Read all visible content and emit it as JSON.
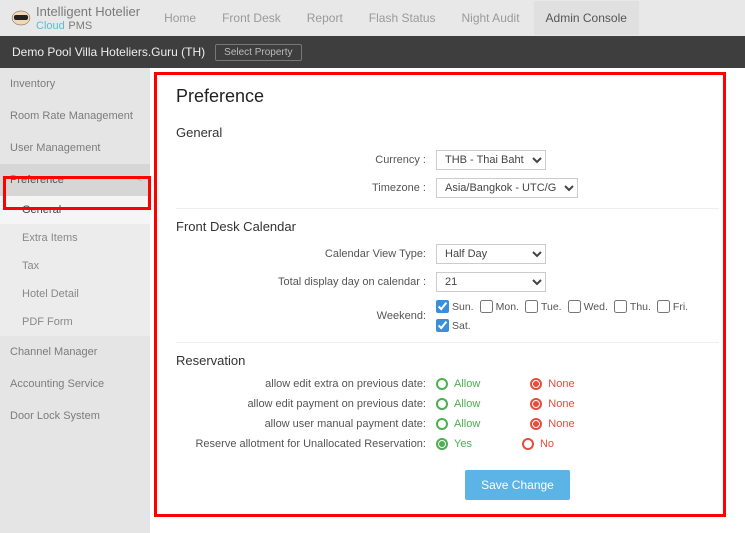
{
  "brand": {
    "top": "Intelligent Hotelier",
    "sub": "Cloud",
    "pms": "PMS"
  },
  "topnav": [
    {
      "label": "Home"
    },
    {
      "label": "Front Desk"
    },
    {
      "label": "Report"
    },
    {
      "label": "Flash Status"
    },
    {
      "label": "Night Audit"
    },
    {
      "label": "Admin Console"
    }
  ],
  "propbar": {
    "property": "Demo Pool Villa Hoteliers.Guru (TH)",
    "select_label": "Select Property"
  },
  "sidebar": {
    "items": [
      {
        "label": "Inventory"
      },
      {
        "label": "Room Rate Management"
      },
      {
        "label": "User Management"
      },
      {
        "label": "Preference",
        "active": true,
        "chev": "<"
      },
      {
        "label": "Channel Manager"
      },
      {
        "label": "Accounting Service"
      },
      {
        "label": "Door Lock System"
      }
    ],
    "preference_sub": [
      {
        "label": "General",
        "active": true
      },
      {
        "label": "Extra Items"
      },
      {
        "label": "Tax"
      },
      {
        "label": "Hotel Detail"
      },
      {
        "label": "PDF Form"
      }
    ]
  },
  "page": {
    "title": "Preference",
    "sections": {
      "general": {
        "title": "General",
        "currency_label": "Currency :",
        "currency_value": "THB - Thai Baht",
        "timezone_label": "Timezone :",
        "timezone_value": "Asia/Bangkok - UTC/G"
      },
      "front_desk": {
        "title": "Front Desk Calendar",
        "view_type_label": "Calendar View Type:",
        "view_type_value": "Half Day",
        "total_days_label": "Total display day on calendar :",
        "total_days_value": "21",
        "weekend_label": "Weekend:",
        "days": [
          {
            "label": "Sun.",
            "checked": true
          },
          {
            "label": "Mon.",
            "checked": false
          },
          {
            "label": "Tue.",
            "checked": false
          },
          {
            "label": "Wed.",
            "checked": false
          },
          {
            "label": "Thu.",
            "checked": false
          },
          {
            "label": "Fri.",
            "checked": false
          },
          {
            "label": "Sat.",
            "checked": true
          }
        ]
      },
      "reservation": {
        "title": "Reservation",
        "rows": [
          {
            "label": "allow edit extra on previous date:",
            "yes": "Allow",
            "no": "None",
            "selected": "no"
          },
          {
            "label": "allow edit payment on previous date:",
            "yes": "Allow",
            "no": "None",
            "selected": "no"
          },
          {
            "label": "allow user manual payment date:",
            "yes": "Allow",
            "no": "None",
            "selected": "no"
          },
          {
            "label": "Reserve allotment for Unallocated Reservation:",
            "yes": "Yes",
            "no": "No",
            "selected": "yes"
          }
        ]
      }
    },
    "save_label": "Save Change"
  }
}
